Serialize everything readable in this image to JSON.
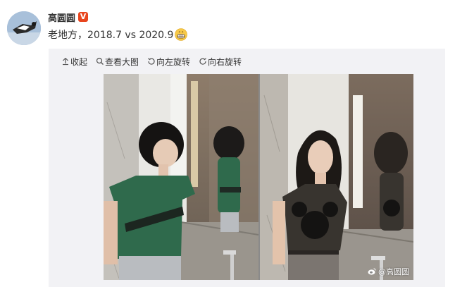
{
  "post": {
    "author": "高圆圆",
    "verified_badge": "V",
    "text": "老地方，2018.7 vs 2020.9",
    "emoji_icon": "grinning-face-icon"
  },
  "toolbar": {
    "collapse": "收起",
    "view_large": "查看大图",
    "rotate_left": "向左旋转",
    "rotate_right": "向右旋转"
  },
  "image": {
    "watermark": "@高圆圆"
  },
  "colors": {
    "verified": "#e8451e",
    "toolbar_bg": "#f2f2f5",
    "green_shirt": "#2f6a4c",
    "dark_shirt": "#38342f"
  }
}
